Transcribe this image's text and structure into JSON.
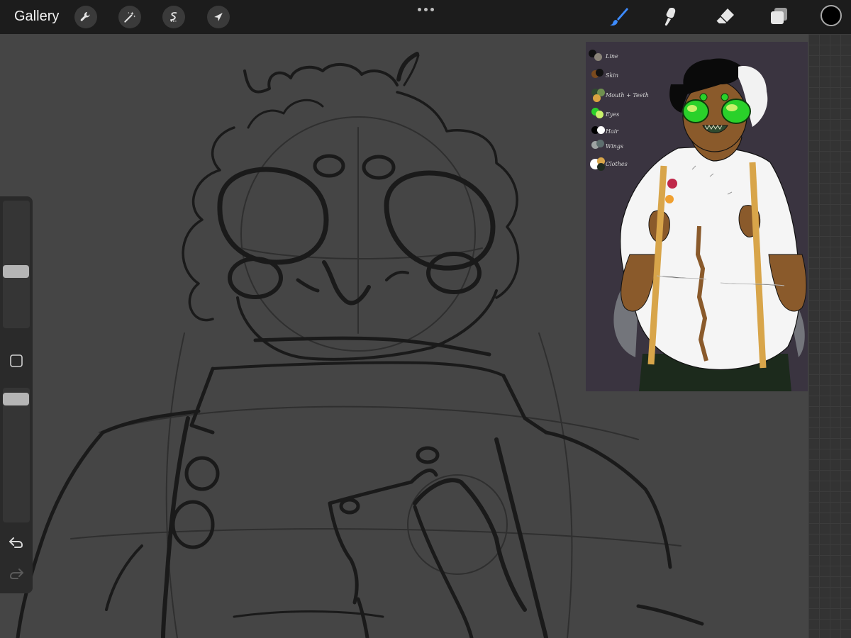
{
  "app": {
    "gallery_label": "Gallery"
  },
  "toolbar": {
    "left_tools": [
      {
        "icon": "wrench-icon",
        "name": "actions"
      },
      {
        "icon": "magic-wand-icon",
        "name": "adjustments"
      },
      {
        "icon": "selection-s-icon",
        "name": "selection"
      },
      {
        "icon": "transform-arrow-icon",
        "name": "transform"
      }
    ],
    "right_tools": [
      {
        "icon": "brush-icon",
        "name": "paint",
        "active": true
      },
      {
        "icon": "smudge-icon",
        "name": "smudge"
      },
      {
        "icon": "eraser-icon",
        "name": "erase"
      },
      {
        "icon": "layers-icon",
        "name": "layers"
      }
    ],
    "current_color": "#000000",
    "active_color": "#3d8bff"
  },
  "sidebar": {
    "brush_size_level": 0.44,
    "opacity_level": 0.12,
    "modify_icon": "square-modify-icon",
    "undo_icon": "undo-icon",
    "redo_icon": "redo-icon"
  },
  "reference": {
    "swatches": [
      {
        "label": "Line",
        "colors": [
          "#111111",
          "#8a8478"
        ]
      },
      {
        "label": "Skin",
        "colors": [
          "#7a4a1e",
          "#111111"
        ]
      },
      {
        "label": "Mouth + Teeth",
        "colors": [
          "#2f4a2f",
          "#6f8f4f",
          "#d9a441"
        ]
      },
      {
        "label": "Eyes",
        "colors": [
          "#2ad12a",
          "#c8f06a"
        ]
      },
      {
        "label": "Hair",
        "colors": [
          "#000000",
          "#ffffff"
        ]
      },
      {
        "label": "Wings",
        "colors": [
          "#9ea3a3",
          "#5d6e6e"
        ]
      },
      {
        "label": "Clothes",
        "colors": [
          "#ffffff",
          "#d8a54a",
          "#1f2a1f"
        ]
      }
    ]
  }
}
